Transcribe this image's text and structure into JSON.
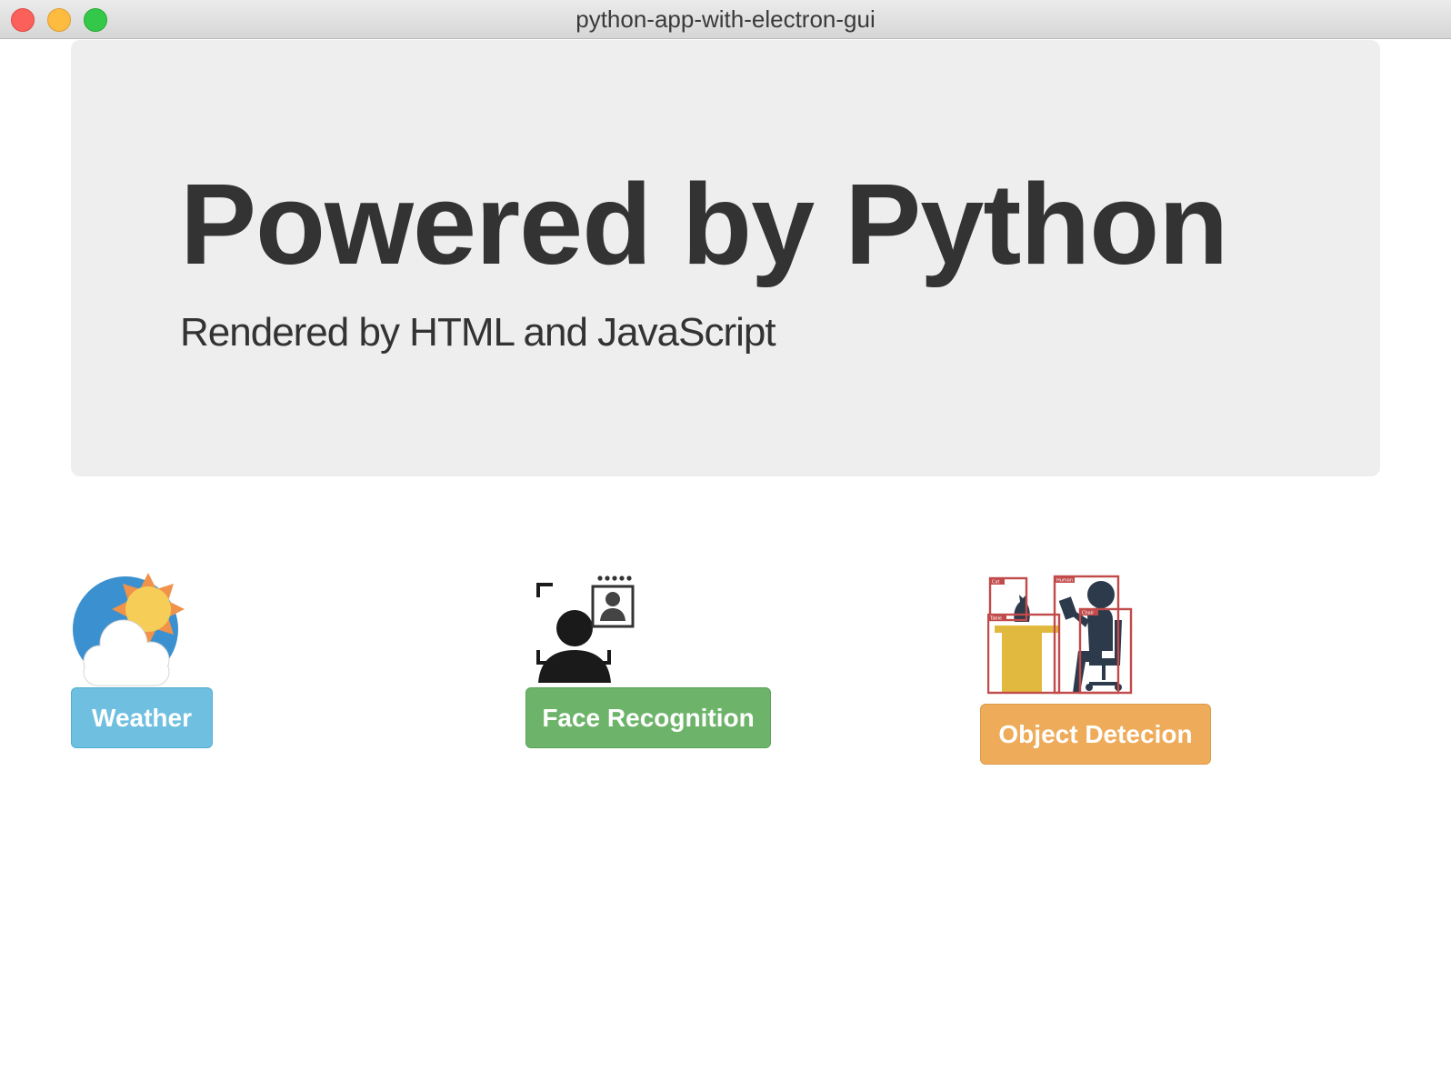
{
  "window": {
    "title": "python-app-with-electron-gui"
  },
  "hero": {
    "title": "Powered by Python",
    "subtitle": "Rendered by HTML and JavaScript"
  },
  "features": [
    {
      "name": "weather",
      "icon": "weather-icon",
      "button_label": "Weather",
      "color": "#6ebfe0"
    },
    {
      "name": "face-recognition",
      "icon": "face-recognition-icon",
      "button_label": "Face Recognition",
      "color": "#6db46a"
    },
    {
      "name": "object-detection",
      "icon": "object-detection-icon",
      "button_label": "Object Detecion",
      "color": "#eeab5a"
    }
  ],
  "object_detection_labels": {
    "cat": "Cat",
    "table": "Table",
    "human": "Human",
    "chair": "Chair"
  }
}
